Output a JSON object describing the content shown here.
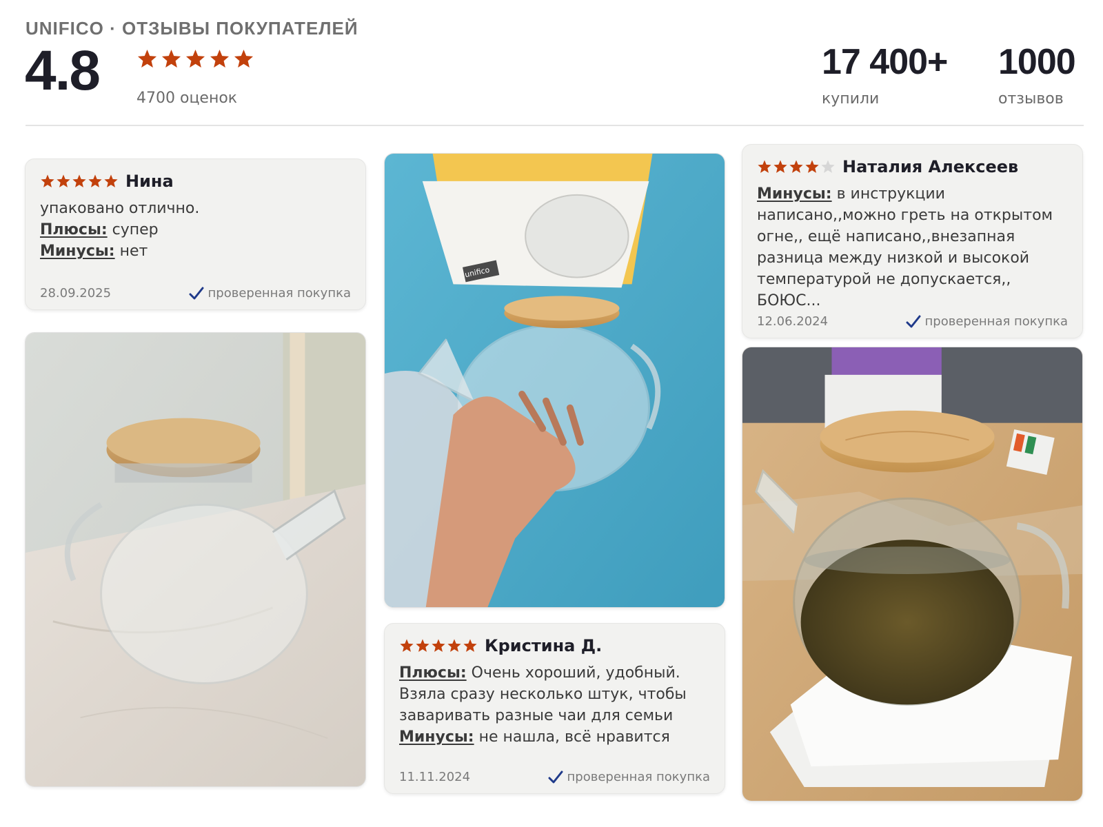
{
  "header": {
    "brand_line": "UNIFICO · ОТЗЫВЫ ПОКУПАТЕЛЕЙ",
    "rating": "4.8",
    "rating_count": "4700 оценок",
    "stars": 5,
    "stats": [
      {
        "value": "17 400+",
        "label": "купили"
      },
      {
        "value": "1000",
        "label": "отзывов"
      }
    ]
  },
  "colors": {
    "star": "#c2410c",
    "star_empty": "#d6d6d6",
    "check": "#1f3a8a",
    "card_bg": "#f2f2f0"
  },
  "reviews": [
    {
      "author": "Нина",
      "stars": 5,
      "lines": [
        {
          "key": "",
          "text": "упаковано отлично."
        },
        {
          "key": "Плюсы:",
          "text": " супер"
        },
        {
          "key": "Минусы:",
          "text": " нет"
        }
      ],
      "date": "28.09.2025",
      "verified": "проверенная покупка"
    },
    {
      "author": "Наталия Алексеев",
      "stars": 4,
      "lines": [
        {
          "key": "Минусы:",
          "text": " в инструкции написано,,можно греть на открытом огне,, ещё написано,,внезапная разница между низкой и высокой температурой не допускается,, БОЮС..."
        }
      ],
      "date": "12.06.2024",
      "verified": "проверенная покупка"
    },
    {
      "author": "Кристина Д.",
      "stars": 5,
      "lines": [
        {
          "key": "Плюсы:",
          "text": " Очень хороший, удобный. Взяла сразу несколько штук, чтобы заваривать разные чаи для семьи"
        },
        {
          "key": "Минусы:",
          "text": " не нашла, всё нравится"
        }
      ],
      "date": "11.11.2024",
      "verified": "проверенная покупка"
    }
  ],
  "box_label": "unifico"
}
